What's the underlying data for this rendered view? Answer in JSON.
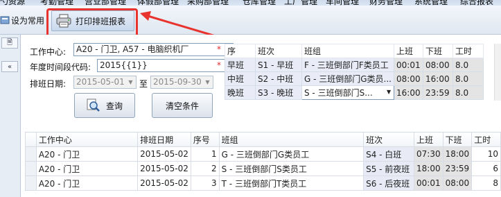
{
  "menu": {
    "items": [
      "勺资源",
      "考勤管理",
      "营业部管理",
      "体假部管理",
      "采购部管理",
      "仓库管理",
      "工厂管理",
      "车间管理",
      "财务管理",
      "系统管理",
      "综合报表"
    ]
  },
  "toolbar": {
    "set_common_label": "设为常用",
    "print_label": "打印排班报表"
  },
  "left": {
    "tab1": "🗎",
    "tab2": "«"
  },
  "filters": {
    "work_center_label": "工作中心:",
    "work_center_value": "A20 - 门卫, A57 - 电脑织机厂",
    "period_label": "年度时间段代码:",
    "period_value": "2015{{1}}",
    "date_label": "排班日期:",
    "date_from": "2015-05-01",
    "date_to_sep": "至",
    "date_to": "2015-09-30",
    "required_mark": "*",
    "query_label": "查询",
    "clear_label": "清空条件"
  },
  "shift_table": {
    "headers": [
      "序",
      "班次",
      "班组",
      "上班",
      "下班",
      "工时"
    ],
    "rows": [
      {
        "seq": "早班",
        "shift": "S1 - 早班",
        "group": "F - 三班倒部门F类员工",
        "start": "00:01",
        "end": "08:00",
        "hours": "8.0"
      },
      {
        "seq": "中班",
        "shift": "S2 - 中班",
        "group": "G - 三班倒部门G类员...",
        "start": "08:00",
        "end": "16:00",
        "hours": "8.0"
      },
      {
        "seq": "晚班",
        "shift": "S3 - 晚班",
        "group": "S - 三班倒部门S...",
        "start": "16:00",
        "end": "23:59",
        "hours": "8.0"
      }
    ]
  },
  "grid": {
    "headers": [
      "工作中心",
      "排班日期",
      "序号",
      "班组",
      "班次",
      "上班",
      "下班",
      "工时"
    ],
    "rows": [
      {
        "center": "A20 - 门卫",
        "date": "2015-05-02",
        "no": "1",
        "group": "G - 三班倒部门G类员工",
        "shift": "S4 - 白班",
        "start": "07:30",
        "end": "18:00",
        "hours": "10"
      },
      {
        "center": "A20 - 门卫",
        "date": "2015-05-02",
        "no": "2",
        "group": "S - 三班倒部门S类员工",
        "shift": "S5 - 前夜班",
        "start": "18:00",
        "end": "23:59",
        "hours": "6"
      },
      {
        "center": "A20 - 门卫",
        "date": "2015-05-02",
        "no": "3",
        "group": "T - 三班倒部门T类员工",
        "shift": "S6 - 后夜班",
        "start": "00:01",
        "end": "08:00",
        "hours": "8"
      }
    ]
  },
  "colors": {
    "highlight": "#e8332f",
    "required": "#d92c2c"
  }
}
